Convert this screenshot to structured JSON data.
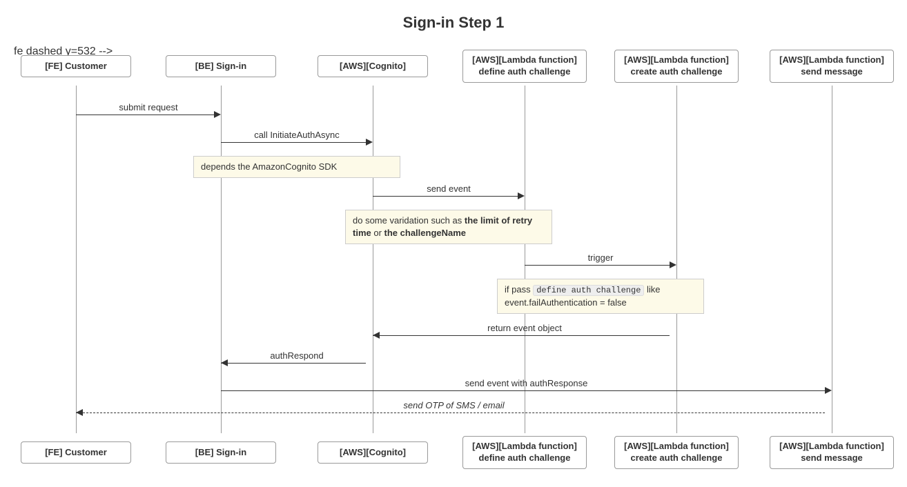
{
  "title": "Sign-in Step 1",
  "actors": {
    "fe": "[FE] Customer",
    "be": "[BE] Sign-in",
    "cognito": "[AWS][Cognito]",
    "define": "[AWS][Lambda function]\ndefine auth challenge",
    "create": "[AWS][Lambda function]\ncreate auth challenge",
    "send": "[AWS][Lambda function]\nsend message"
  },
  "messages": {
    "submit": "submit request",
    "initiate": "call InitiateAuthAsync",
    "sendEvent": "send event",
    "trigger": "trigger",
    "returnEvent": "return event object",
    "authRespond": "authRespond",
    "sendAuthResp": "send event with authResponse",
    "sendOtp": "send OTP of SMS / email"
  },
  "notes": {
    "sdk": "depends the AmazonCognito SDK",
    "validation_pre": "do some varidation such as ",
    "validation_b1": "the limit of retry time",
    "validation_mid": " or ",
    "validation_b2": "the challengeName",
    "ifpass_pre": "if pass ",
    "ifpass_code": "define auth challenge",
    "ifpass_post": " like event.failAuthentication = false"
  }
}
